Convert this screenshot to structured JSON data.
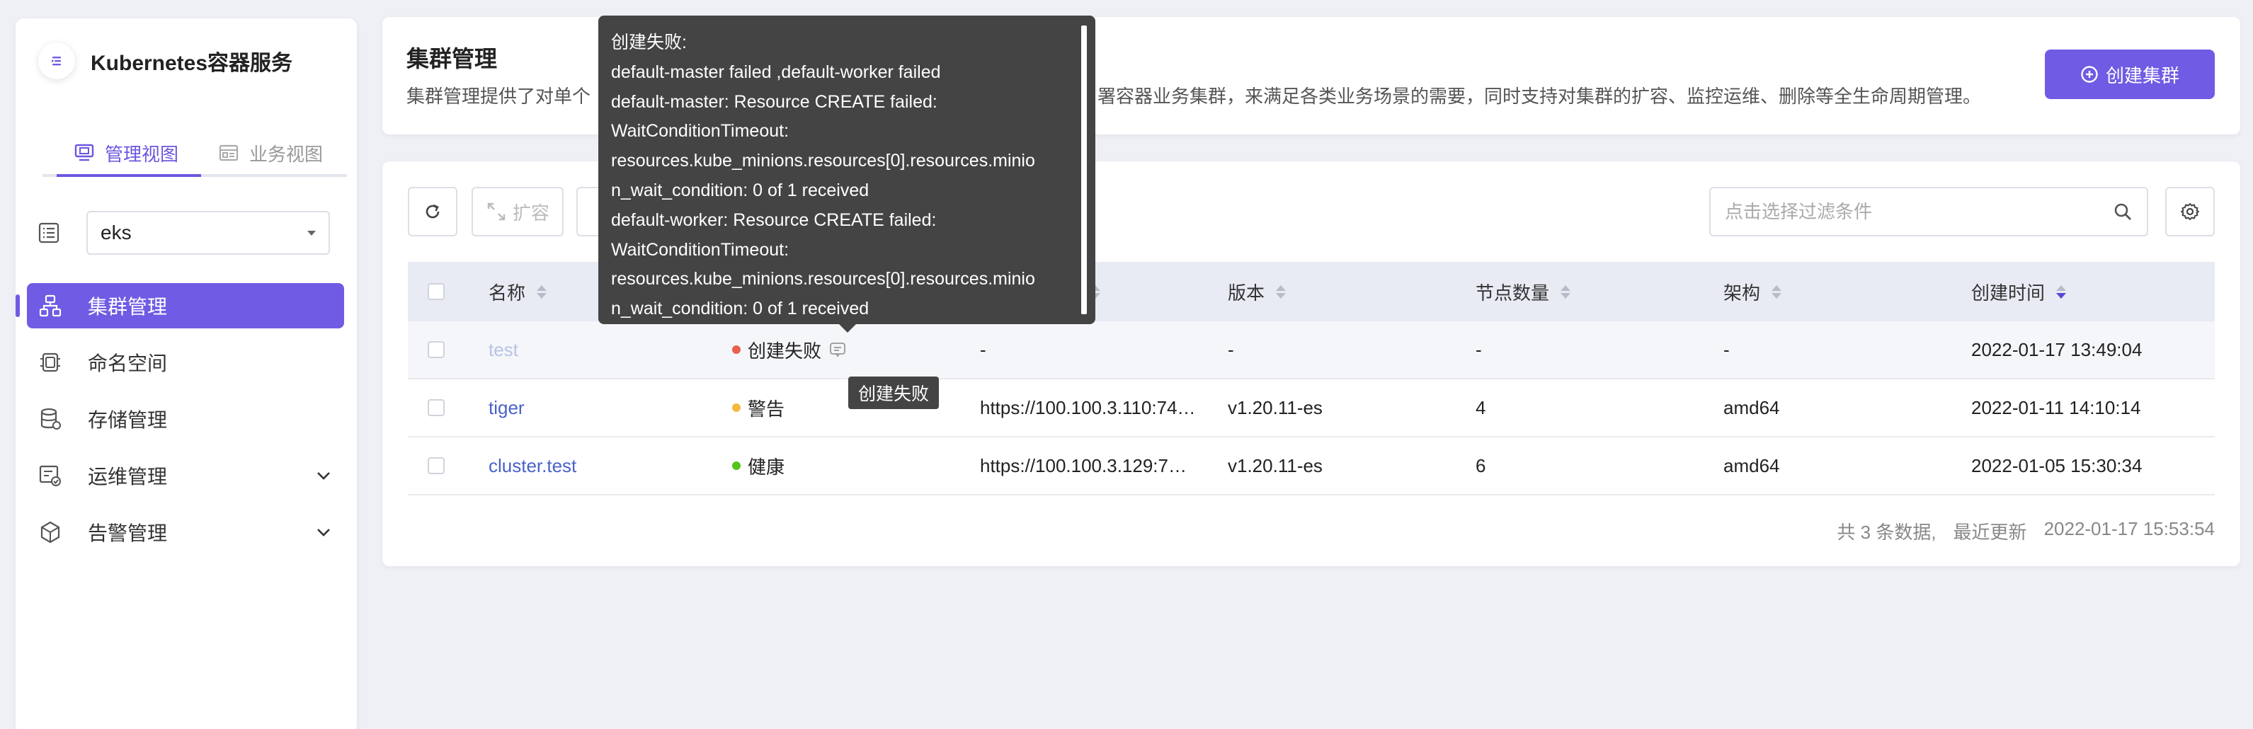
{
  "app": {
    "title": "Kubernetes容器服务",
    "views": [
      {
        "label": "管理视图",
        "active": true
      },
      {
        "label": "业务视图",
        "active": false
      }
    ],
    "cluster_select": {
      "value": "eks"
    }
  },
  "menu": [
    {
      "label": "集群管理",
      "icon": "cluster-icon",
      "active": true
    },
    {
      "label": "命名空间",
      "icon": "namespace-icon",
      "active": false
    },
    {
      "label": "存储管理",
      "icon": "storage-icon",
      "active": false
    },
    {
      "label": "运维管理",
      "icon": "ops-icon",
      "active": false,
      "expandable": true
    },
    {
      "label": "告警管理",
      "icon": "alert-icon",
      "active": false,
      "expandable": true
    }
  ],
  "header": {
    "title": "集群管理",
    "desc_start": "集群管理提供了对单个",
    "desc_end": "署容器业务集群，来满足各类业务场景的需要，同时支持对集群的扩容、监控运维、删除等全生命周期管理。",
    "create_button": "创建集群"
  },
  "toolbar": {
    "expand_label": "扩容",
    "filter_placeholder": "点击选择过滤条件"
  },
  "table": {
    "columns": [
      "名称",
      "版本",
      "节点数量",
      "架构",
      "创建时间"
    ],
    "rows": [
      {
        "name": "test",
        "status": "创建失败",
        "status_color": "#e8604c",
        "address": "-",
        "version": "-",
        "nodes": "-",
        "arch": "-",
        "created": "2022-01-17 13:49:04"
      },
      {
        "name": "tiger",
        "status": "警告",
        "status_color": "#f5b942",
        "address": "https://100.100.3.110:74…",
        "version": "v1.20.11-es",
        "nodes": "4",
        "arch": "amd64",
        "created": "2022-01-11 14:10:14"
      },
      {
        "name": "cluster.test",
        "status": "健康",
        "status_color": "#52c41a",
        "address": "https://100.100.3.129:7…",
        "version": "v1.20.11-es",
        "nodes": "6",
        "arch": "amd64",
        "created": "2022-01-05 15:30:34"
      }
    ]
  },
  "footer": {
    "total": "共 3 条数据,",
    "updated_label": "最近更新",
    "updated_time": "2022-01-17 15:53:54"
  },
  "tooltip": {
    "lines": [
      "创建失败:",
      "default-master failed ,default-worker failed",
      "default-master: Resource CREATE failed:",
      "WaitConditionTimeout:",
      "resources.kube_minions.resources[0].resources.minio",
      "n_wait_condition: 0 of 1 received",
      "default-worker: Resource CREATE failed:",
      "WaitConditionTimeout:",
      "resources.kube_minions.resources[0].resources.minio",
      "n_wait_condition: 0 of 1 received"
    ],
    "mini": "创建失败"
  },
  "colors": {
    "accent": "#6f5be4",
    "link": "#4a62c9"
  }
}
